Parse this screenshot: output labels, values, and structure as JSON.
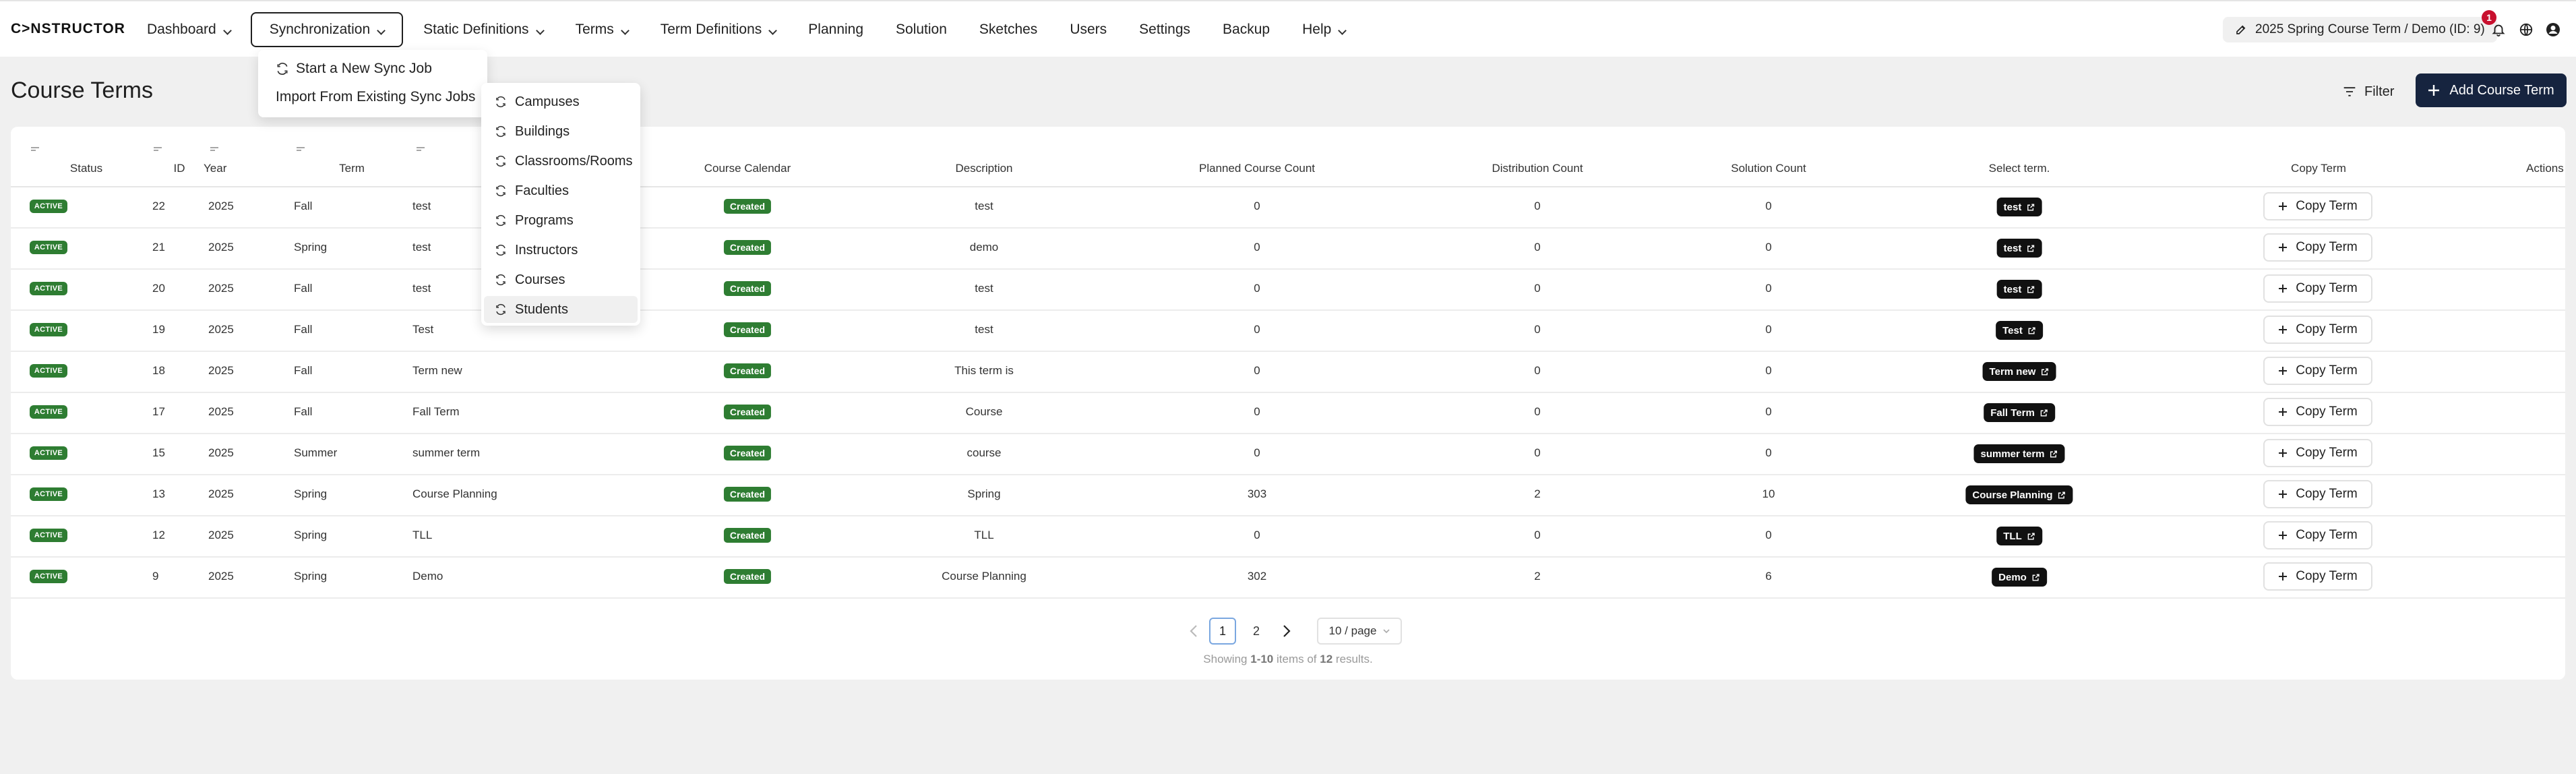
{
  "app": {
    "logo": "C>NSTRUCTOR"
  },
  "nav": [
    {
      "label": "Dashboard",
      "dropdown": true
    },
    {
      "label": "Synchronization",
      "dropdown": true,
      "open": true
    },
    {
      "label": "Static Definitions",
      "dropdown": true
    },
    {
      "label": "Terms",
      "dropdown": true
    },
    {
      "label": "Term Definitions",
      "dropdown": true
    },
    {
      "label": "Planning",
      "dropdown": false
    },
    {
      "label": "Solution",
      "dropdown": false
    },
    {
      "label": "Sketches",
      "dropdown": false
    },
    {
      "label": "Users",
      "dropdown": false
    },
    {
      "label": "Settings",
      "dropdown": false
    },
    {
      "label": "Backup",
      "dropdown": false
    },
    {
      "label": "Help",
      "dropdown": true
    }
  ],
  "header": {
    "current_term": "2025 Spring Course Term / Demo (ID: 9)",
    "notification_count": "1"
  },
  "sync_menu": {
    "start_job": "Start a New Sync Job",
    "import_jobs": "Import From Existing Sync Jobs"
  },
  "import_submenu": [
    "Campuses",
    "Buildings",
    "Classrooms/Rooms",
    "Faculties",
    "Programs",
    "Instructors",
    "Courses",
    "Students"
  ],
  "page": {
    "title": "Course Terms",
    "filter_label": "Filter",
    "add_label": "Add Course Term"
  },
  "table": {
    "columns": {
      "status": "Status",
      "id": "ID",
      "year": "Year",
      "term": "Term",
      "calendar": "Course Calendar",
      "description": "Description",
      "planned": "Planned Course Count",
      "distribution": "Distribution Count",
      "solution": "Solution Count",
      "select": "Select term.",
      "copy": "Copy Term",
      "actions": "Actions"
    },
    "copy_label": "Copy Term",
    "rows": [
      {
        "status": "ACTIVE",
        "id": "22",
        "year": "2025",
        "term": "Fall",
        "name": "test",
        "calendar": "Created",
        "description": "test",
        "planned": "0",
        "distribution": "0",
        "solution": "0",
        "select": "test"
      },
      {
        "status": "ACTIVE",
        "id": "21",
        "year": "2025",
        "term": "Spring",
        "name": "test",
        "calendar": "Created",
        "description": "demo",
        "planned": "0",
        "distribution": "0",
        "solution": "0",
        "select": "test"
      },
      {
        "status": "ACTIVE",
        "id": "20",
        "year": "2025",
        "term": "Fall",
        "name": "test",
        "calendar": "Created",
        "description": "test",
        "planned": "0",
        "distribution": "0",
        "solution": "0",
        "select": "test"
      },
      {
        "status": "ACTIVE",
        "id": "19",
        "year": "2025",
        "term": "Fall",
        "name": "Test",
        "calendar": "Created",
        "description": "test",
        "planned": "0",
        "distribution": "0",
        "solution": "0",
        "select": "Test"
      },
      {
        "status": "ACTIVE",
        "id": "18",
        "year": "2025",
        "term": "Fall",
        "name": "Term new",
        "calendar": "Created",
        "description": "This term is",
        "planned": "0",
        "distribution": "0",
        "solution": "0",
        "select": "Term new"
      },
      {
        "status": "ACTIVE",
        "id": "17",
        "year": "2025",
        "term": "Fall",
        "name": "Fall Term",
        "calendar": "Created",
        "description": "Course",
        "planned": "0",
        "distribution": "0",
        "solution": "0",
        "select": "Fall Term"
      },
      {
        "status": "ACTIVE",
        "id": "15",
        "year": "2025",
        "term": "Summer",
        "name": "summer term",
        "calendar": "Created",
        "description": "course",
        "planned": "0",
        "distribution": "0",
        "solution": "0",
        "select": "summer term"
      },
      {
        "status": "ACTIVE",
        "id": "13",
        "year": "2025",
        "term": "Spring",
        "name": "Course Planning",
        "calendar": "Created",
        "description": "Spring",
        "planned": "303",
        "distribution": "2",
        "solution": "10",
        "select": "Course Planning"
      },
      {
        "status": "ACTIVE",
        "id": "12",
        "year": "2025",
        "term": "Spring",
        "name": "TLL",
        "calendar": "Created",
        "description": "TLL",
        "planned": "0",
        "distribution": "0",
        "solution": "0",
        "select": "TLL"
      },
      {
        "status": "ACTIVE",
        "id": "9",
        "year": "2025",
        "term": "Spring",
        "name": "Demo",
        "calendar": "Created",
        "description": "Course Planning",
        "planned": "302",
        "distribution": "2",
        "solution": "6",
        "select": "Demo"
      }
    ]
  },
  "pagination": {
    "pages": [
      "1",
      "2"
    ],
    "current": "1",
    "page_size": "10 / page",
    "showing_prefix": "Showing",
    "showing_range": "1-10",
    "showing_mid": "items of",
    "showing_total": "12",
    "showing_suffix": "results."
  },
  "colors": {
    "primary": "#16243f",
    "status_green": "#2e7d32",
    "badge_red": "#c8102e"
  }
}
